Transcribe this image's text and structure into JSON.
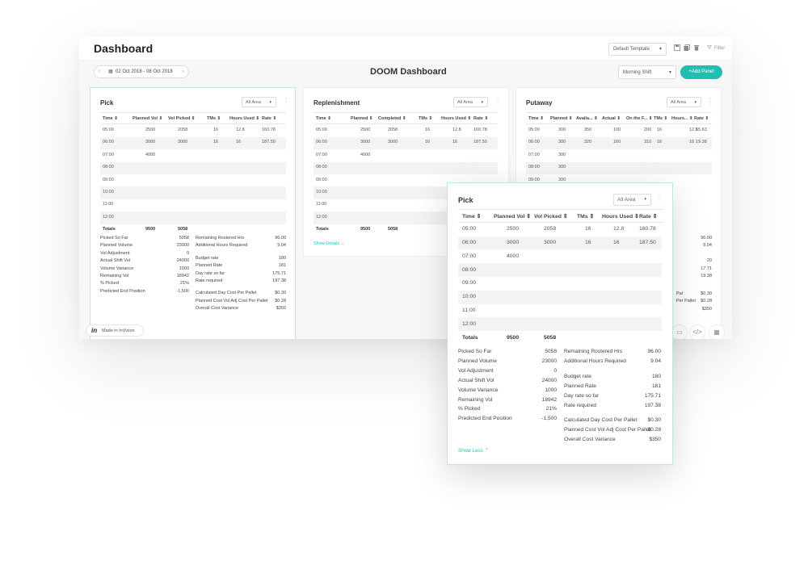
{
  "app": {
    "title": "Dashboard",
    "template_select": "Default Template",
    "filter_label": "Filter",
    "date_range": "02 Oct 2018 - 08 Oct 2018",
    "dashboard_title": "DOOM Dashboard",
    "shift_select": "Morning Shift",
    "add_panel_label": "+Add Panel",
    "made_in": "Made in InVision"
  },
  "icons": {
    "prev": "chevron-left-icon",
    "next": "chevron-right-icon",
    "calendar": "calendar-icon",
    "save": "save-icon",
    "copy": "copy-icon",
    "delete": "trash-icon",
    "filter": "filter-icon",
    "more": "kebab-icon",
    "code": "code-icon",
    "grid": "grid-icon",
    "comment": "comment-icon"
  },
  "accent_color": "#21bfb2",
  "pick": {
    "title": "Pick",
    "area": "All Area",
    "headers": [
      "Time",
      "Planned Vol",
      "Vol Picked",
      "TMs",
      "Hours Used",
      "Rate"
    ],
    "rows": [
      [
        "05:00",
        "2500",
        "2058",
        "16",
        "12.8",
        "160.78"
      ],
      [
        "06:00",
        "3000",
        "3000",
        "16",
        "16",
        "187.50"
      ],
      [
        "07:00",
        "4000",
        "",
        "",
        "",
        ""
      ],
      [
        "08:00",
        "",
        "",
        "",
        "",
        ""
      ],
      [
        "09:00",
        "",
        "",
        "",
        "",
        ""
      ],
      [
        "10:00",
        "",
        "",
        "",
        "",
        ""
      ],
      [
        "11:00",
        "",
        "",
        "",
        "",
        ""
      ],
      [
        "12:00",
        "",
        "",
        "",
        "",
        ""
      ]
    ],
    "totals": [
      "Totals",
      "9500",
      "5058",
      "",
      "",
      ""
    ],
    "stats_left": [
      [
        "Picked So Far",
        "5058"
      ],
      [
        "Planned Volume",
        "23000"
      ],
      [
        "Vol Adjustment",
        "0"
      ],
      [
        "Actual Shift Vol",
        "24000"
      ],
      [
        "Volume Variance",
        "1000"
      ],
      [
        "Remaining Vol",
        "18942"
      ],
      [
        "% Picked",
        "21%"
      ],
      [
        "Predicted End Position",
        "-1,500"
      ]
    ],
    "stats_right_1": [
      [
        "Remaining Rostered Hrs",
        "96.00"
      ],
      [
        "Additional Hours Required",
        "9.04"
      ]
    ],
    "stats_right_2": [
      [
        "Budget rate",
        "180"
      ],
      [
        "Planned Rate",
        "181"
      ],
      [
        "Day rate so far",
        "175.71"
      ],
      [
        "Rate required",
        "197.38"
      ]
    ],
    "stats_right_3": [
      [
        "Calculated Day Cost Per Pallet",
        "$0.30"
      ],
      [
        "Planned Cost Vol Adj Cost Per Pallet",
        "$0.28"
      ],
      [
        "Overall Cost Variance",
        "$350"
      ]
    ],
    "show_less": "Show Less"
  },
  "replenishment": {
    "title": "Replenishment",
    "area": "All Area",
    "headers": [
      "Time",
      "Planned",
      "Completed",
      "TMs",
      "Hours Used",
      "Rate"
    ],
    "rows": [
      [
        "05:00",
        "2500",
        "2058",
        "16",
        "12.8",
        "160.78"
      ],
      [
        "06:00",
        "3000",
        "3000",
        "16",
        "16",
        "187.50"
      ],
      [
        "07:00",
        "4000",
        "",
        "",
        "",
        ""
      ],
      [
        "08:00",
        "",
        "",
        "",
        "",
        ""
      ],
      [
        "09:00",
        "",
        "",
        "",
        "",
        ""
      ],
      [
        "10:00",
        "",
        "",
        "",
        "",
        ""
      ],
      [
        "11:00",
        "",
        "",
        "",
        "",
        ""
      ],
      [
        "12:00",
        "",
        "",
        "",
        "",
        ""
      ]
    ],
    "totals": [
      "Totals",
      "9500",
      "5058",
      "",
      "",
      ""
    ],
    "show_details": "Show Details"
  },
  "putaway": {
    "title": "Putaway",
    "area": "All Area",
    "headers": [
      "Time",
      "Planned",
      "Availa...",
      "Actual",
      "On the F...",
      "TMs",
      "Hours...",
      "Rate"
    ],
    "rows": [
      [
        "05:00",
        "300",
        "350",
        "100",
        "200",
        "16",
        "12.8",
        "15.63"
      ],
      [
        "06:00",
        "300",
        "320",
        "160",
        "310",
        "16",
        "16",
        "19.38"
      ],
      [
        "07:00",
        "300",
        "",
        "",
        "",
        "",
        "",
        ""
      ],
      [
        "08:00",
        "300",
        "",
        "",
        "",
        "",
        "",
        ""
      ],
      [
        "09:00",
        "300",
        "",
        "",
        "",
        "",
        "",
        ""
      ]
    ],
    "stats_visible": [
      "96.00",
      "9.04",
      "20",
      "17.71",
      "19.38",
      "$0.30",
      "$0.28",
      "$350"
    ],
    "stats_labels_visible": [
      "Pal",
      "Per Pallet"
    ]
  }
}
